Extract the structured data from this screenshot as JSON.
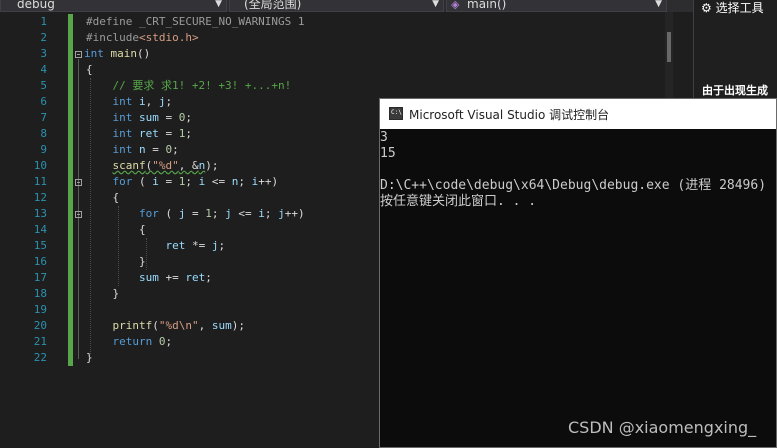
{
  "navbar": {
    "project": "debug",
    "scope": "(全局范围)",
    "member": "main()"
  },
  "editor": {
    "line_numbers": [
      "1",
      "2",
      "3",
      "4",
      "5",
      "6",
      "7",
      "8",
      "9",
      "10",
      "11",
      "12",
      "13",
      "14",
      "15",
      "16",
      "17",
      "18",
      "19",
      "20",
      "21",
      "22"
    ]
  },
  "right_panel": {
    "tools_label": "选择工具",
    "note": "由于出现生成"
  },
  "console": {
    "title": "Microsoft Visual Studio 调试控制台",
    "lines": [
      "3",
      "15",
      "",
      "D:\\C++\\code\\debug\\x64\\Debug\\debug.exe (进程 28496)",
      "按任意键关闭此窗口. . ."
    ]
  },
  "watermark": "CSDN @xiaomengxing_",
  "colors": {
    "keyword": "#569cd6",
    "comment": "#57a64a",
    "string": "#d69d85",
    "function": "#dcdcaa",
    "background": "#1e1e1e"
  }
}
